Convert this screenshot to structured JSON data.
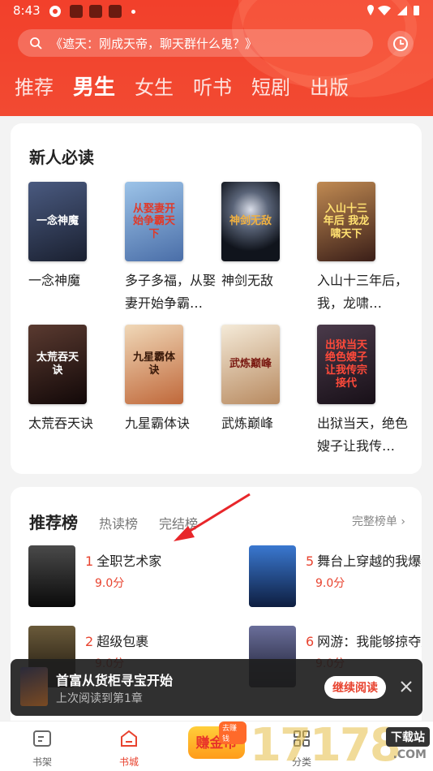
{
  "status": {
    "time": "8:43"
  },
  "search": {
    "placeholder": "《遮天：刚成天帝，聊天群什么鬼？》"
  },
  "tabs": [
    {
      "label": "推荐",
      "active": false
    },
    {
      "label": "男生",
      "active": true
    },
    {
      "label": "女生",
      "active": false
    },
    {
      "label": "听书",
      "active": false
    },
    {
      "label": "短剧",
      "active": false
    },
    {
      "label": "出版",
      "active": false
    }
  ],
  "new_readers": {
    "title": "新人必读",
    "books": [
      {
        "name": "一念神魔",
        "cover_text": "一念神魔",
        "cover_color": "#2a3550"
      },
      {
        "name": "多子多福，从娶妻开始争霸…",
        "cover_text": "从娶妻开始争霸天下",
        "cover_color": "#5a86b8"
      },
      {
        "name": "神剑无敌",
        "cover_text": "神剑无敌",
        "cover_color": "#1c2433"
      },
      {
        "name": "入山十三年后，我，龙啸…",
        "cover_text": "入山十三年后 我龙啸天下",
        "cover_color": "#5b2f22"
      },
      {
        "name": "太荒吞天诀",
        "cover_text": "太荒吞天诀",
        "cover_color": "#2b1a18"
      },
      {
        "name": "九星霸体诀",
        "cover_text": "九星霸体诀",
        "cover_color": "#b86a34"
      },
      {
        "name": "武炼巅峰",
        "cover_text": "武炼巅峰",
        "cover_color": "#d8c7a8"
      },
      {
        "name": "出狱当天，绝色嫂子让我传…",
        "cover_text": "出狱当天 绝色嫂子让我传宗接代",
        "cover_color": "#2b2030"
      }
    ]
  },
  "ranking": {
    "tabs": [
      {
        "label": "推荐榜",
        "active": true
      },
      {
        "label": "热读榜",
        "active": false
      },
      {
        "label": "完结榜",
        "active": false
      }
    ],
    "more": "完整榜单",
    "items": [
      {
        "num": "1",
        "title": "全职艺术家",
        "score": "9.0分",
        "cover_color": "#1e1e1e"
      },
      {
        "num": "2",
        "title": "超级包裹",
        "score": "9.0分",
        "cover_color": "#2a2418"
      },
      {
        "num": "5",
        "title": "舞台上穿越的我爆红",
        "score": "9.0分",
        "cover_color": "#1f3d7a"
      },
      {
        "num": "6",
        "title": "网游：我能够掠夺属",
        "score": "9.0分",
        "cover_color": "#3b3f5a"
      }
    ]
  },
  "continue_reading": {
    "title": "首富从货柜寻宝开始",
    "subtitle": "上次阅读到第1章",
    "button": "继续阅读"
  },
  "bottom_nav": [
    {
      "label": "书架",
      "active": false
    },
    {
      "label": "书城",
      "active": true
    },
    {
      "label": "分类",
      "active": false
    }
  ],
  "coin": {
    "label": "赚金币",
    "tag": "去赚钱"
  },
  "watermark": {
    "main": "17178",
    "tag": "下载站",
    "sub": ".COM"
  }
}
